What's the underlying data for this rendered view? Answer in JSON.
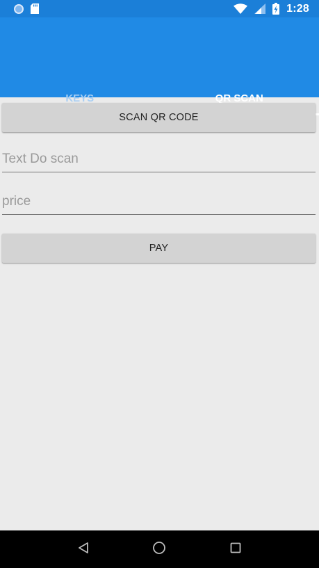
{
  "status_bar": {
    "time": "1:28",
    "icons": [
      "notification-dot-icon",
      "sd-card-icon",
      "wifi-icon",
      "signal-icon",
      "battery-charging-icon"
    ]
  },
  "tabs": [
    {
      "label": "KEYS",
      "active": false
    },
    {
      "label": "QR SCAN",
      "active": true
    }
  ],
  "main": {
    "scan_button_label": "SCAN QR CODE",
    "scan_field_placeholder": "Text Do scan",
    "scan_field_value": "",
    "price_field_placeholder": "price",
    "price_field_value": "",
    "pay_button_label": "PAY"
  },
  "nav_bar": {
    "icons": [
      "back-icon",
      "home-icon",
      "recents-icon"
    ]
  },
  "colors": {
    "status_bar": "#1b7fd8",
    "app_bar": "#208ae5",
    "background": "#ebebeb",
    "button": "#d3d3d3"
  }
}
